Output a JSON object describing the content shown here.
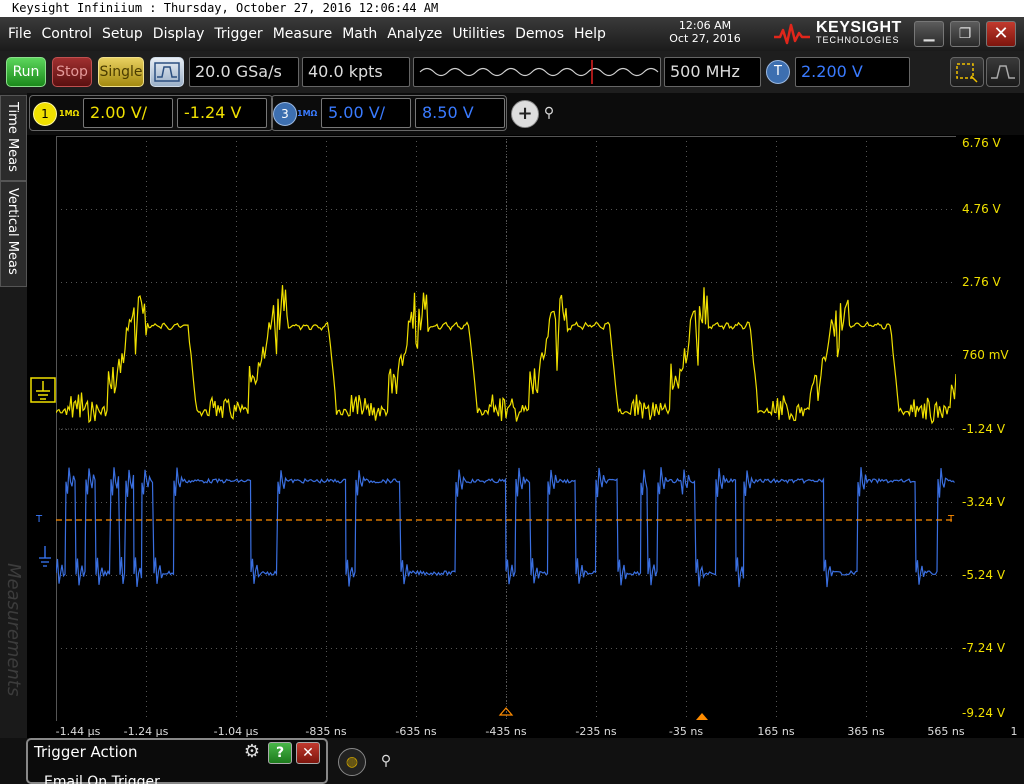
{
  "window": {
    "title": "Keysight Infiniium : Thursday, October 27, 2016 12:06:44 AM"
  },
  "menu": [
    "File",
    "Control",
    "Setup",
    "Display",
    "Trigger",
    "Measure",
    "Math",
    "Analyze",
    "Utilities",
    "Demos",
    "Help"
  ],
  "clock": {
    "time": "12:06 AM",
    "date": "Oct 27, 2016"
  },
  "brand": {
    "name": "KEYSIGHT",
    "sub": "TECHNOLOGIES"
  },
  "toolbar": {
    "run": "Run",
    "stop": "Stop",
    "single": "Single",
    "sample_rate": "20.0 GSa/s",
    "memory_depth": "40.0 kpts",
    "bandwidth": "500 MHz",
    "trigger_badge": "T",
    "trigger_level": "2.200 V"
  },
  "side_tabs": {
    "time_meas": "Time Meas",
    "vertical_meas": "Vertical Meas",
    "measurements": "Measurements"
  },
  "channels": {
    "ch1": {
      "number": "1",
      "impedance": "1MΩ",
      "scale": "2.00 V/",
      "offset": "-1.24 V",
      "color": "#f0e000"
    },
    "ch3": {
      "number": "3",
      "impedance": "1MΩ",
      "scale": "5.00 V/",
      "offset": "8.50 V",
      "color": "#3a7bff"
    }
  },
  "screen": {
    "y_labels": [
      "6.76 V",
      "4.76 V",
      "2.76 V",
      "760 mV",
      "-1.24 V",
      "-3.24 V",
      "-5.24 V",
      "-7.24 V",
      "-9.24 V"
    ],
    "x_labels": [
      "-1.44 µs",
      "-1.24 µs",
      "-1.04 µs",
      "-835 ns",
      "-635 ns",
      "-435 ns",
      "-235 ns",
      "-35 ns",
      "165 ns",
      "365 ns",
      "565 ns"
    ],
    "x_axis_end": "1",
    "trigger_marker": "T",
    "trigger_line_color": "#ff8c00",
    "grid_color": "#555555"
  },
  "trigger_action": {
    "title": "Trigger Action",
    "item": "Email On Trigger"
  }
}
